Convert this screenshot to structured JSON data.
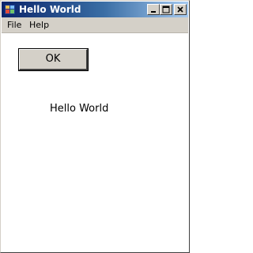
{
  "window": {
    "title": "Hello World"
  },
  "menu": {
    "file_label": "File",
    "help_label": "Help"
  },
  "main": {
    "ok_button_label": "OK",
    "hello_text": "Hello World"
  },
  "colors": {
    "titlebar_start": "#0a246a",
    "titlebar_end": "#a6caf0",
    "face": "#d4d0c8",
    "background": "#ffffff"
  }
}
